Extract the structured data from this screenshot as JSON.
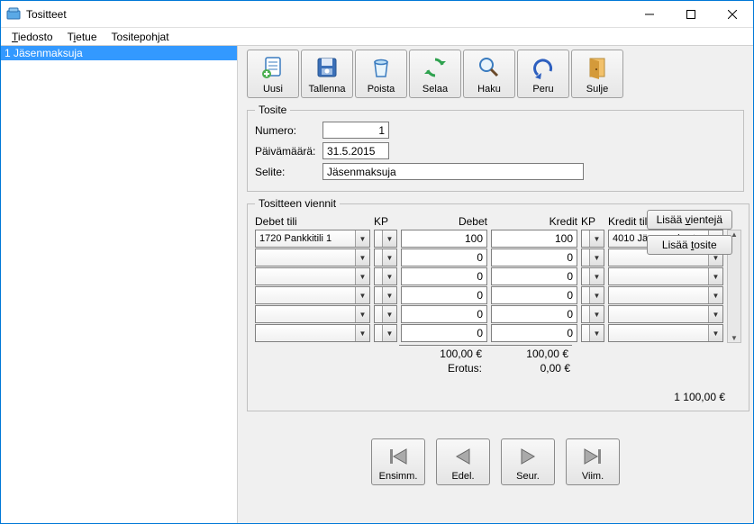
{
  "window": {
    "title": "Tositteet"
  },
  "menu": {
    "file": "Tiedosto",
    "record": "Tietue",
    "templates": "Tositepohjat"
  },
  "sidebar": {
    "items": [
      {
        "label": "1 Jäsenmaksuja",
        "selected": true
      }
    ]
  },
  "toolbar": {
    "new": "Uusi",
    "save": "Tallenna",
    "delete": "Poista",
    "browse": "Selaa",
    "search": "Haku",
    "undo": "Peru",
    "close": "Sulje"
  },
  "voucher": {
    "legend": "Tosite",
    "number_label": "Numero:",
    "number": "1",
    "date_label": "Päivämäärä:",
    "date": "31.5.2015",
    "desc_label": "Selite:",
    "desc": "Jäsenmaksuja"
  },
  "entries": {
    "legend": "Tositteen viennit",
    "headers": {
      "debit_acct": "Debet tili",
      "kp1": "KP",
      "debit": "Debet",
      "credit": "Kredit",
      "kp2": "KP",
      "credit_acct": "Kredit tili"
    },
    "rows": [
      {
        "debit_acct": "1720 Pankkitili 1",
        "kp1": "",
        "debit": "100",
        "credit": "100",
        "kp2": "",
        "credit_acct": "4010 Jäsenmaksut"
      },
      {
        "debit_acct": "",
        "kp1": "",
        "debit": "0",
        "credit": "0",
        "kp2": "",
        "credit_acct": ""
      },
      {
        "debit_acct": "",
        "kp1": "",
        "debit": "0",
        "credit": "0",
        "kp2": "",
        "credit_acct": ""
      },
      {
        "debit_acct": "",
        "kp1": "",
        "debit": "0",
        "credit": "0",
        "kp2": "",
        "credit_acct": ""
      },
      {
        "debit_acct": "",
        "kp1": "",
        "debit": "0",
        "credit": "0",
        "kp2": "",
        "credit_acct": ""
      },
      {
        "debit_acct": "",
        "kp1": "",
        "debit": "0",
        "credit": "0",
        "kp2": "",
        "credit_acct": ""
      }
    ],
    "totals": {
      "debit": "100,00 €",
      "credit": "100,00 €"
    },
    "diff_label": "Erotus:",
    "diff_value": "0,00 €",
    "add_entries": "Lisää vientejä",
    "add_voucher": "Lisää tosite",
    "balance": "1 100,00 €"
  },
  "nav": {
    "first": "Ensimm.",
    "prev": "Edel.",
    "next": "Seur.",
    "last": "Viim."
  }
}
